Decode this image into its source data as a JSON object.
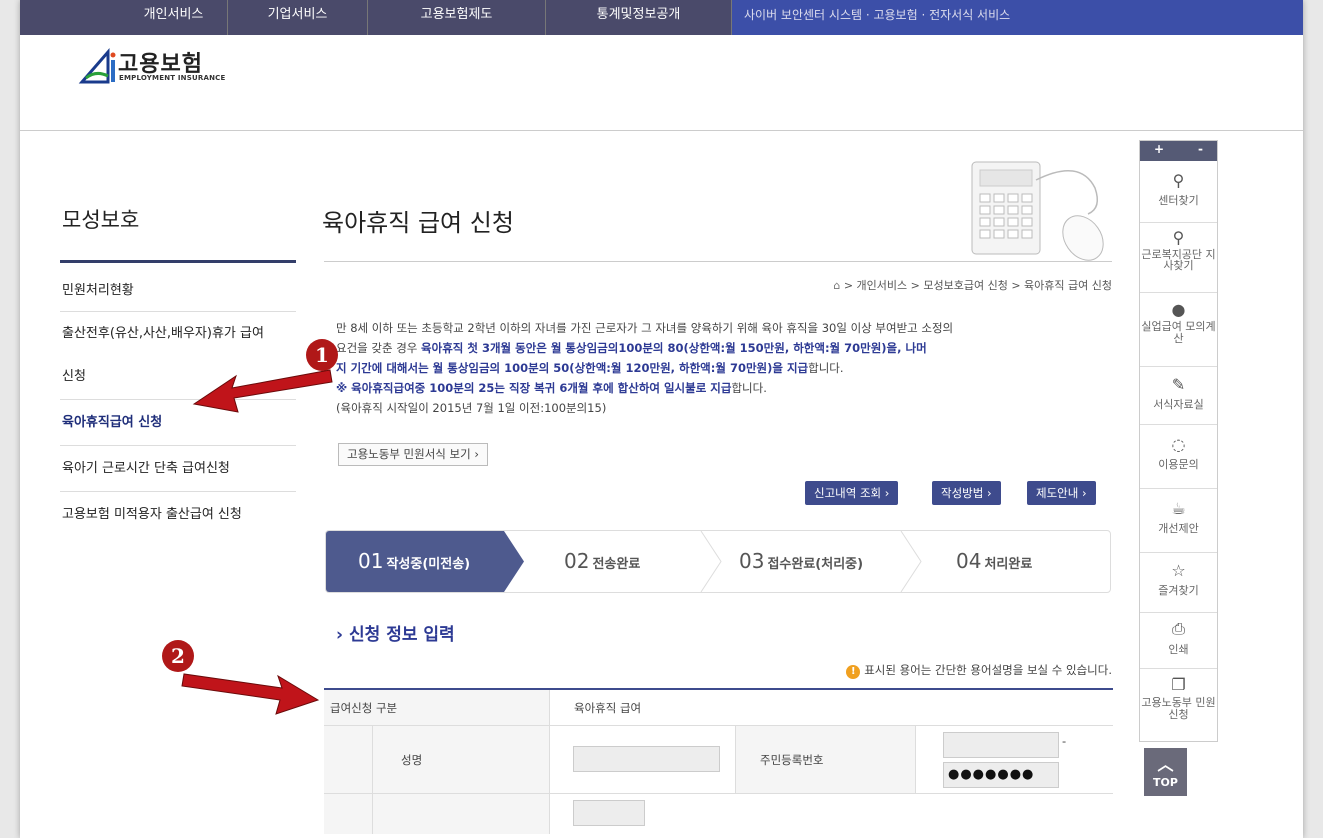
{
  "topnav": {
    "items": [
      "개인서비스",
      "기업서비스",
      "고용보험제도",
      "통계및정보공개"
    ],
    "accent_text": "사이버 보안센터 시스템 · 고용보험 · 전자서식 서비스"
  },
  "logo": {
    "ko": "고용보험",
    "en": "EMPLOYMENT INSURANCE"
  },
  "sidebar": {
    "title": "모성보호",
    "items": [
      "민원처리현황",
      "출산전후(유산,사산,배우자)휴가 급여",
      "신청",
      "육아휴직급여 신청",
      "육아기 근로시간 단축 급여신청",
      "고용보험 미적용자 출산급여 신청"
    ]
  },
  "main": {
    "title": "육아휴직 급여 신청",
    "breadcrumb": "> 개인서비스 > 모성보호급여 신청 > 육아휴직 급여 신청",
    "desc": {
      "p1": "만 8세 이하 또는 초등학교 2학년 이하의 자녀를 가진 근로자가 그 자녀를 양육하기 위해 육아 휴직을 30일 이상 부여받고 소정의",
      "p2a": "요건을 갖춘 경우 ",
      "p2b": "육아휴직 첫 3개월 동안은 월 통상임금의100분의 80(상한액:월 150만원, 하한액:월 70만원)을, 나머",
      "p3a": "지 기간에 대해서는 월 통상임금의 100분의 50(상한액:월 120만원, 하한액:월 70만원)을 지급",
      "p3b": "합니다.",
      "p4a": "※ 육아휴직급여중 100분의 25는 직장 복귀 6개월 후에 합산하여 일시불로 지급",
      "p4b": "합니다.",
      "p5": "(육아휴직 시작일이 2015년 7월 1일 이전:100분의15)"
    },
    "form_button": "고용노동부 민원서식 보기 ›",
    "buttons": [
      "신고내역 조회 ›",
      "작성방법 ›",
      "제도안내 ›"
    ],
    "steps": [
      {
        "num": "01",
        "label": "작성중(미전송)"
      },
      {
        "num": "02",
        "label": "전송완료"
      },
      {
        "num": "03",
        "label": "접수완료(처리중)"
      },
      {
        "num": "04",
        "label": "처리완료"
      }
    ],
    "section_title": "신청 정보 입력",
    "hint": "표시된 용어는 간단한 용어설명을 보실 수 있습니다.",
    "table": {
      "row1_label": "급여신청 구분",
      "row1_value": "육아휴직 급여",
      "name_label": "성명",
      "rrn_label": "주민등록번호",
      "rrn_dash": "-",
      "rrn_masked": "●●●●●●●"
    }
  },
  "rightbar": {
    "zoom_plus": "+",
    "zoom_minus": "-",
    "items": [
      {
        "icon": "location-pin-icon",
        "label": "센터찾기"
      },
      {
        "icon": "location-pin-icon",
        "label": "근로복지공단 지사찾기"
      },
      {
        "icon": "user-icon",
        "label": "실업급여 모의계산"
      },
      {
        "icon": "edit-icon",
        "label": "서식자료실"
      },
      {
        "icon": "chat-icon",
        "label": "이용문의"
      },
      {
        "icon": "coffee-icon",
        "label": "개선제안"
      },
      {
        "icon": "star-icon",
        "label": "즐겨찾기"
      },
      {
        "icon": "print-icon",
        "label": "인쇄"
      },
      {
        "icon": "document-icon",
        "label": "고용노동부 민원신청"
      }
    ],
    "top_label": "TOP"
  },
  "annotations": {
    "badge1": "1",
    "badge2": "2"
  },
  "colors": {
    "navy": "#3e4b8d",
    "accent_blue": "#2d3a94",
    "arrow_red": "#c0141a"
  }
}
